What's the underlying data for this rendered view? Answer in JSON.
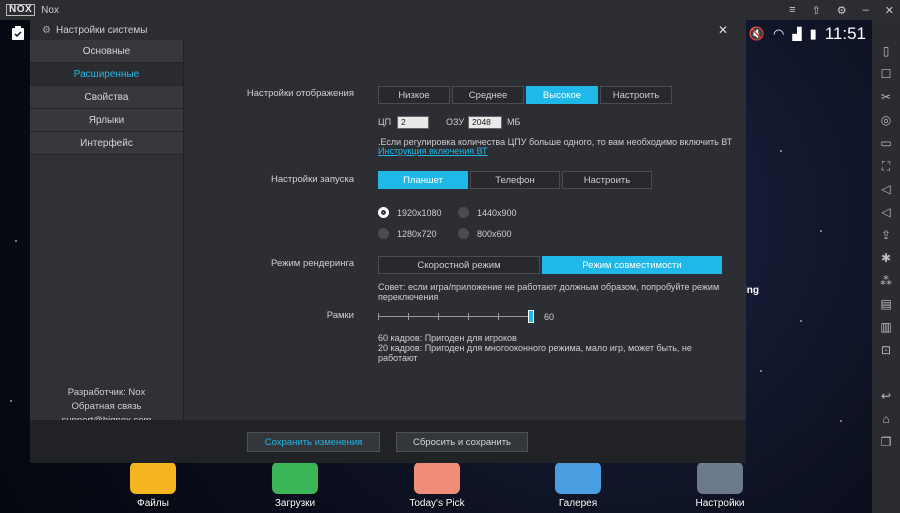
{
  "titlebar": {
    "logo": "NOX",
    "app_name": "Nox"
  },
  "statusbar": {
    "clock": "11:51"
  },
  "dialog": {
    "title": "Настройки системы",
    "nav": [
      {
        "label": "Основные",
        "active": false
      },
      {
        "label": "Расширенные",
        "active": true
      },
      {
        "label": "Свойства",
        "active": false
      },
      {
        "label": "Ярлыки",
        "active": false
      },
      {
        "label": "Интерфейс",
        "active": false
      }
    ],
    "developer": "Разработчик: Nox",
    "feedback": "Обратная связь",
    "email": "support@bignox.com",
    "display": {
      "label": "Настройки отображения",
      "options": [
        "Низкое",
        "Среднее",
        "Высокое",
        "Настроить"
      ],
      "selected": "Высокое",
      "cpu_label": "ЦП",
      "cpu_value": "2",
      "ram_label": "ОЗУ",
      "ram_value": "2048",
      "ram_unit": "МБ",
      "vt_note": ".Если регулировка количества ЦПУ больше одного, то вам необходимо включить ВТ",
      "vt_link": "Инструкция включения ВТ"
    },
    "startup": {
      "label": "Настройки запуска",
      "options": [
        "Планшет",
        "Телефон",
        "Настроить"
      ],
      "selected": "Планшет",
      "resolutions": [
        "1920x1080",
        "1440x900",
        "1280x720",
        "800x600"
      ],
      "selected_resolution": "1920x1080"
    },
    "render": {
      "label": "Режим рендеринга",
      "options": [
        "Скоростной режим",
        "Режим совместимости"
      ],
      "selected": "Режим совместимости",
      "tip": "Совет: если игра/приложение не работают должным образом, попробуйте режим переключения"
    },
    "frames": {
      "label": "Рамки",
      "value": "60",
      "note1": "60 кадров: Пригоден для игроков",
      "note2": "20 кадров: Пригоден для многооконного режима, мало игр, может быть, не работают"
    },
    "footer": {
      "save": "Сохранить изменения",
      "reset": "Сбросить и сохранить"
    }
  },
  "dock": {
    "apps": [
      "Файлы",
      "Загрузки",
      "Today's Pick",
      "Галерея",
      "Настройки"
    ],
    "side_text": "ing"
  },
  "colors": {
    "accent": "#1fb8e8",
    "dialog_bg": "#2f3136"
  }
}
